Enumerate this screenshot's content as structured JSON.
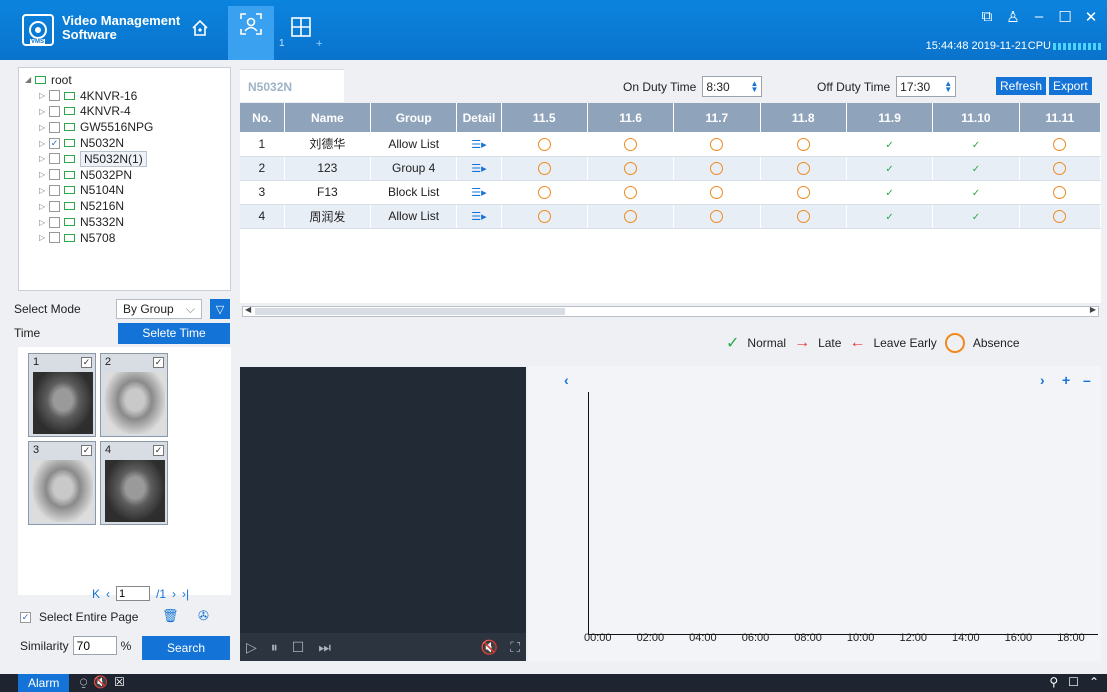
{
  "app": {
    "title_line1": "Video Management",
    "title_line2": "Software",
    "logo_text": "VMS",
    "face_tab_count": "1",
    "grid_tab_plus": "+"
  },
  "status": {
    "clock": "15:44:48 2019-11-21",
    "cpu_label": "CPU"
  },
  "tree": {
    "root": "root",
    "items": [
      {
        "label": "4KNVR-16",
        "checked": false
      },
      {
        "label": "4KNVR-4",
        "checked": false
      },
      {
        "label": "GW5516NPG",
        "checked": false
      },
      {
        "label": "N5032N",
        "checked": true
      },
      {
        "label": "N5032N(1)",
        "checked": false,
        "selected": true
      },
      {
        "label": "N5032PN",
        "checked": false
      },
      {
        "label": "N5104N",
        "checked": false
      },
      {
        "label": "N5216N",
        "checked": false
      },
      {
        "label": "N5332N",
        "checked": false
      },
      {
        "label": "N5708",
        "checked": false
      }
    ]
  },
  "filters": {
    "select_mode_label": "Select Mode",
    "select_mode_value": "By Group",
    "time_label": "Time",
    "select_time_button": "Selete Time"
  },
  "faces": [
    {
      "num": "1",
      "checked": true,
      "tone": "dark"
    },
    {
      "num": "2",
      "checked": true,
      "tone": "light"
    },
    {
      "num": "3",
      "checked": true,
      "tone": "light"
    },
    {
      "num": "4",
      "checked": true,
      "tone": "dark"
    }
  ],
  "pager": {
    "current": "1",
    "total": "/1"
  },
  "search": {
    "select_entire_label": "Select Entire Page",
    "similarity_label": "Similarity",
    "similarity_value": "70",
    "percent": "%",
    "search_button": "Search"
  },
  "attendance": {
    "tab_label": "N5032N",
    "on_duty_label": "On Duty Time",
    "on_duty_value": "8:30",
    "off_duty_label": "Off Duty Time",
    "off_duty_value": "17:30",
    "refresh_button": "Refresh",
    "export_button": "Export",
    "columns": [
      "No.",
      "Name",
      "Group",
      "Detail",
      "11.5",
      "11.6",
      "11.7",
      "11.8",
      "11.9",
      "11.10",
      "11.11"
    ],
    "rows": [
      {
        "no": "1",
        "name": "刘德华",
        "group": "Allow List",
        "days": [
          "absence",
          "absence",
          "absence",
          "absence",
          "normal",
          "normal",
          "absence"
        ]
      },
      {
        "no": "2",
        "name": "123",
        "group": "Group 4",
        "days": [
          "absence",
          "absence",
          "absence",
          "absence",
          "normal",
          "normal",
          "absence"
        ]
      },
      {
        "no": "3",
        "name": "F13",
        "group": "Block List",
        "days": [
          "absence",
          "absence",
          "absence",
          "absence",
          "normal",
          "normal",
          "absence"
        ]
      },
      {
        "no": "4",
        "name": "周润发",
        "group": "Allow List",
        "days": [
          "absence",
          "absence",
          "absence",
          "absence",
          "normal",
          "normal",
          "absence"
        ]
      }
    ]
  },
  "legend": {
    "normal": "Normal",
    "late": "Late",
    "leave_early": "Leave Early",
    "absence": "Absence"
  },
  "timeline": {
    "ticks": [
      "00:00",
      "02:00",
      "04:00",
      "06:00",
      "08:00",
      "10:00",
      "12:00",
      "14:00",
      "16:00",
      "18:00"
    ]
  },
  "bottom": {
    "alarm": "Alarm"
  },
  "colors": {
    "accent": "#1473d6",
    "titlebar": "#0a73cc",
    "normal": "#2aa84a",
    "absence": "#f08a1e",
    "late": "#e33333"
  }
}
